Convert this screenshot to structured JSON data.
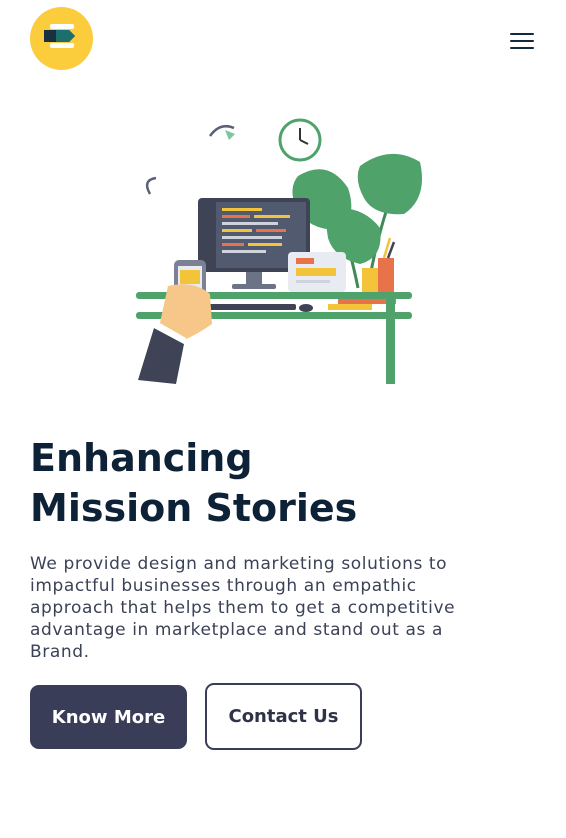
{
  "header": {
    "logo_icon": "brand-b-logo",
    "menu_icon": "hamburger-menu-icon"
  },
  "hero": {
    "illustration": "office-desk-illustration",
    "title_line1": "Enhancing",
    "title_line2": "Mission Stories",
    "description_lines": [
      "We provide design and marketing solutions to",
      "impactful businesses through an empathic",
      "approach that helps them to get a competitive",
      "advantage in marketplace and stand out as a",
      "Brand."
    ],
    "primary_button": "Know More",
    "secondary_button": "Contact Us"
  },
  "colors": {
    "brand_yellow": "#fbcc3c",
    "brand_teal": "#1d6f6d",
    "navy": "#3a3d58",
    "heading": "#0d2237",
    "plant_green": "#4ea26a"
  }
}
